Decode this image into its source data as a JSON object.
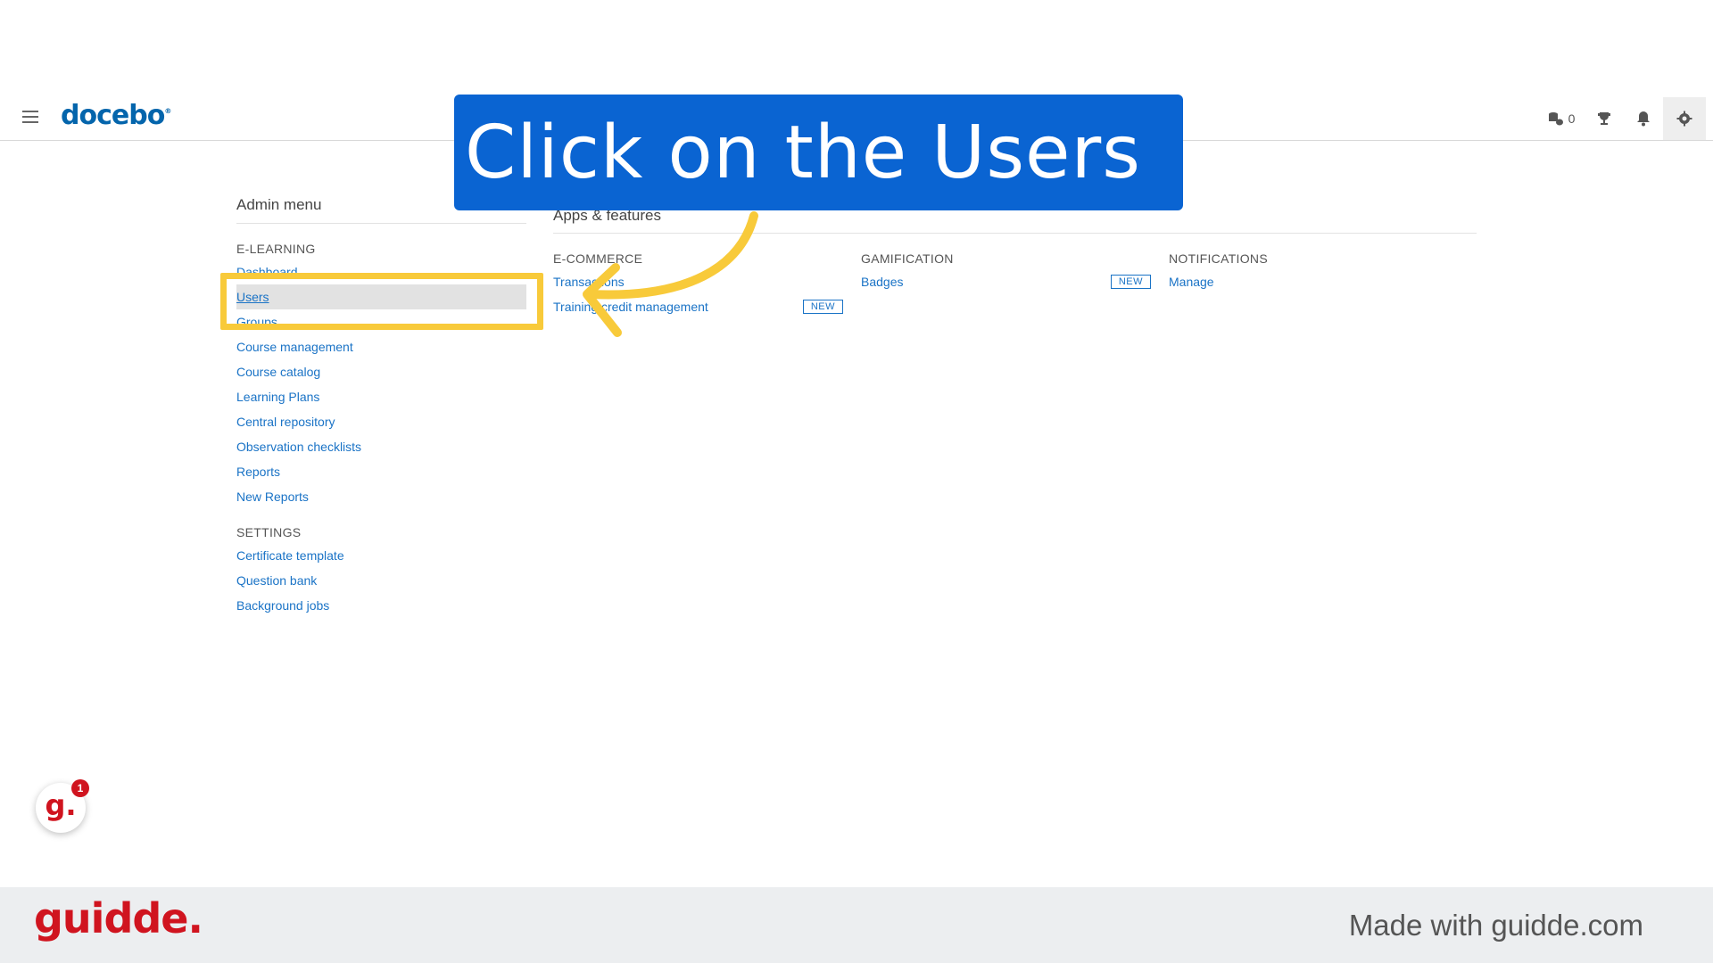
{
  "header": {
    "logo_text": "docebo",
    "logo_mark": "®",
    "coins_count": "0",
    "icons": [
      "menu-icon",
      "coins-icon",
      "trophy-icon",
      "bell-icon",
      "gear-icon"
    ]
  },
  "admin": {
    "title": "Admin menu",
    "elearning_head": "E-LEARNING",
    "elearning_items": [
      {
        "label": "Dashboard"
      },
      {
        "label": "Users"
      },
      {
        "label": "Groups"
      },
      {
        "label": "Course management"
      },
      {
        "label": "Course catalog"
      },
      {
        "label": "Learning Plans"
      },
      {
        "label": "Central repository"
      },
      {
        "label": "Observation checklists"
      },
      {
        "label": "Reports"
      },
      {
        "label": "New Reports"
      }
    ],
    "settings_head": "SETTINGS",
    "settings_items": [
      {
        "label": "Certificate template"
      },
      {
        "label": "Question bank"
      },
      {
        "label": "Background jobs"
      }
    ]
  },
  "apps": {
    "title": "Apps & features",
    "ecommerce_head": "E-COMMERCE",
    "ecommerce_items": [
      {
        "label": "Transactions"
      },
      {
        "label": "Training credit management",
        "badge": "NEW"
      }
    ],
    "gamification_head": "GAMIFICATION",
    "gamification_items": [
      {
        "label": "Badges",
        "badge": "NEW"
      }
    ],
    "notifications_head": "NOTIFICATIONS",
    "notifications_items": [
      {
        "label": "Manage"
      }
    ]
  },
  "overlay": {
    "callout_text": "Click on the Users",
    "highlight_color": "#f8ca3a",
    "callout_color": "#0a64d2"
  },
  "guidde": {
    "fab_letter": "g.",
    "fab_badge": "1",
    "footer_logo": "guidde.",
    "footer_text": "Made with guidde.com"
  }
}
